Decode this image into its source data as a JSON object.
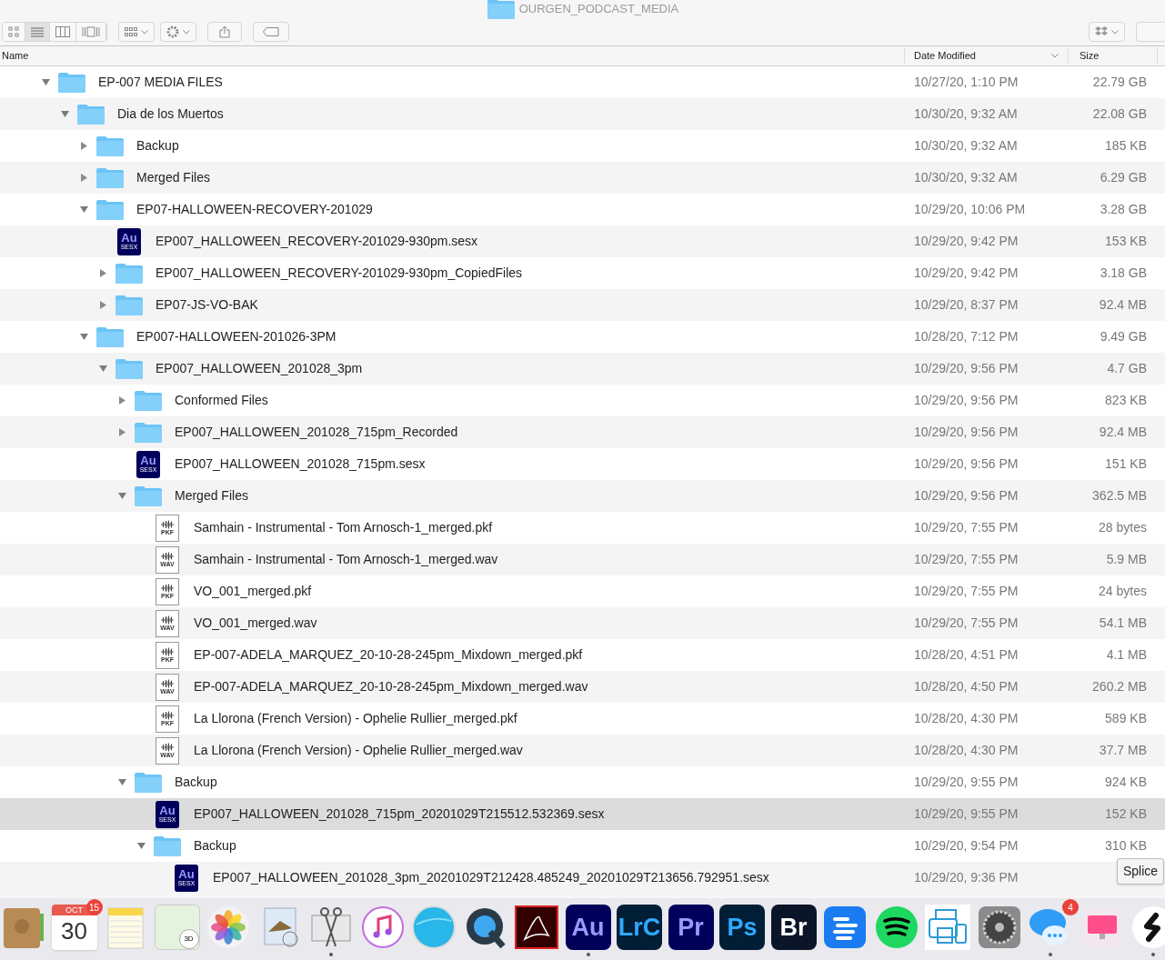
{
  "window": {
    "title": "OURGEN_PODCAST_MEDIA"
  },
  "toolbar": {
    "view_buttons": [
      {
        "kind": "icon",
        "selected": false
      },
      {
        "kind": "list",
        "selected": true
      },
      {
        "kind": "columns",
        "selected": false
      },
      {
        "kind": "gallery",
        "selected": false
      }
    ]
  },
  "table": {
    "columns": [
      {
        "label": "Name",
        "sorted": false
      },
      {
        "label": "Date Modified",
        "sorted": true
      },
      {
        "label": "Size",
        "sorted": false
      }
    ],
    "rows": [
      {
        "kind": "folder",
        "name": "EP-007 MEDIA FILES",
        "date": "10/27/20, 1:10 PM",
        "size": "22.79 GB",
        "expanded": true,
        "selected": false,
        "children": [
          {
            "kind": "folder",
            "name": "Dia de los Muertos",
            "date": "10/30/20, 9:32 AM",
            "size": "22.08 GB",
            "expanded": true,
            "selected": false,
            "children": [
              {
                "kind": "folder",
                "name": "Backup",
                "date": "10/30/20, 9:32 AM",
                "size": "185 KB",
                "expanded": false,
                "selected": false
              },
              {
                "kind": "folder",
                "name": "Merged Files",
                "date": "10/30/20, 9:32 AM",
                "size": "6.29 GB",
                "expanded": false,
                "selected": false
              },
              {
                "kind": "folder",
                "name": "EP07-HALLOWEEN-RECOVERY-201029",
                "date": "10/29/20, 10:06 PM",
                "size": "3.28 GB",
                "expanded": true,
                "selected": false,
                "children": [
                  {
                    "kind": "sesx",
                    "icon_text": [
                      "Au",
                      "SESX"
                    ],
                    "name": "EP007_HALLOWEEN_RECOVERY-201029-930pm.sesx",
                    "date": "10/29/20, 9:42 PM",
                    "size": "153 KB",
                    "selected": false
                  },
                  {
                    "kind": "folder",
                    "name": "EP007_HALLOWEEN_RECOVERY-201029-930pm_CopiedFiles",
                    "date": "10/29/20, 9:42 PM",
                    "size": "3.18 GB",
                    "expanded": false,
                    "selected": false
                  },
                  {
                    "kind": "folder",
                    "name": "EP07-JS-VO-BAK",
                    "date": "10/29/20, 8:37 PM",
                    "size": "92.4 MB",
                    "expanded": false,
                    "selected": false
                  }
                ]
              },
              {
                "kind": "folder",
                "name": "EP007-HALLOWEEN-201026-3PM",
                "date": "10/28/20, 7:12 PM",
                "size": "9.49 GB",
                "expanded": true,
                "selected": false,
                "children": [
                  {
                    "kind": "folder",
                    "name": "EP007_HALLOWEEN_201028_3pm",
                    "date": "10/29/20, 9:56 PM",
                    "size": "4.7 GB",
                    "expanded": true,
                    "selected": false,
                    "children": [
                      {
                        "kind": "folder",
                        "name": "Conformed Files",
                        "date": "10/29/20, 9:56 PM",
                        "size": "823 KB",
                        "expanded": false,
                        "selected": false
                      },
                      {
                        "kind": "folder",
                        "name": "EP007_HALLOWEEN_201028_715pm_Recorded",
                        "date": "10/29/20, 9:56 PM",
                        "size": "92.4 MB",
                        "expanded": false,
                        "selected": false
                      },
                      {
                        "kind": "sesx",
                        "icon_text": [
                          "Au",
                          "SESX"
                        ],
                        "name": "EP007_HALLOWEEN_201028_715pm.sesx",
                        "date": "10/29/20, 9:56 PM",
                        "size": "151 KB",
                        "selected": false
                      },
                      {
                        "kind": "folder",
                        "name": "Merged Files",
                        "date": "10/29/20, 9:56 PM",
                        "size": "362.5 MB",
                        "expanded": true,
                        "selected": false,
                        "children": [
                          {
                            "kind": "audio",
                            "icon_text": [
                              "PKF"
                            ],
                            "name": "Samhain - Instrumental - Tom Arnosch-1_merged.pkf",
                            "date": "10/29/20, 7:55 PM",
                            "size": "28 bytes",
                            "selected": false
                          },
                          {
                            "kind": "audio",
                            "icon_text": [
                              "WAV"
                            ],
                            "name": "Samhain - Instrumental - Tom Arnosch-1_merged.wav",
                            "date": "10/29/20, 7:55 PM",
                            "size": "5.9 MB",
                            "selected": false
                          },
                          {
                            "kind": "audio",
                            "icon_text": [
                              "PKF"
                            ],
                            "name": "VO_001_merged.pkf",
                            "date": "10/29/20, 7:55 PM",
                            "size": "24 bytes",
                            "selected": false
                          },
                          {
                            "kind": "audio",
                            "icon_text": [
                              "WAV"
                            ],
                            "name": "VO_001_merged.wav",
                            "date": "10/29/20, 7:55 PM",
                            "size": "54.1 MB",
                            "selected": false
                          },
                          {
                            "kind": "audio",
                            "icon_text": [
                              "PKF"
                            ],
                            "name": "EP-007-ADELA_MARQUEZ_20-10-28-245pm_Mixdown_merged.pkf",
                            "date": "10/28/20, 4:51 PM",
                            "size": "4.1 MB",
                            "selected": false
                          },
                          {
                            "kind": "audio",
                            "icon_text": [
                              "WAV"
                            ],
                            "name": "EP-007-ADELA_MARQUEZ_20-10-28-245pm_Mixdown_merged.wav",
                            "date": "10/28/20, 4:50 PM",
                            "size": "260.2 MB",
                            "selected": false
                          },
                          {
                            "kind": "audio",
                            "icon_text": [
                              "PKF"
                            ],
                            "name": "La Llorona (French Version) - Ophelie Rullier_merged.pkf",
                            "date": "10/28/20, 4:30 PM",
                            "size": "589 KB",
                            "selected": false
                          },
                          {
                            "kind": "audio",
                            "icon_text": [
                              "WAV"
                            ],
                            "name": "La Llorona (French Version) - Ophelie Rullier_merged.wav",
                            "date": "10/28/20, 4:30 PM",
                            "size": "37.7 MB",
                            "selected": false
                          }
                        ]
                      },
                      {
                        "kind": "folder",
                        "name": "Backup",
                        "date": "10/29/20, 9:55 PM",
                        "size": "924 KB",
                        "expanded": true,
                        "selected": false,
                        "children": [
                          {
                            "kind": "sesx",
                            "icon_text": [
                              "Au",
                              "SESX"
                            ],
                            "name": "EP007_HALLOWEEN_201028_715pm_20201029T215512.532369.sesx",
                            "date": "10/29/20, 9:55 PM",
                            "size": "152 KB",
                            "selected": true
                          },
                          {
                            "kind": "folder",
                            "name": "Backup",
                            "date": "10/29/20, 9:54 PM",
                            "size": "310 KB",
                            "expanded": true,
                            "selected": false,
                            "children": [
                              {
                                "kind": "sesx",
                                "icon_text": [
                                  "Au",
                                  "SESX"
                                ],
                                "name": "EP007_HALLOWEEN_201028_3pm_20201029T212428.485249_20201029T213656.792951.sesx",
                                "date": "10/29/20, 9:36 PM",
                                "selected": false
                              }
                            ]
                          }
                        ]
                      }
                    ]
                  }
                ]
              }
            ]
          }
        ]
      }
    ]
  },
  "tooltip": {
    "text": "Splice"
  },
  "dock": [
    {
      "kind": "contacts",
      "running": false
    },
    {
      "kind": "calendar",
      "month": "OCT",
      "day": "30",
      "badge": "15",
      "running": false
    },
    {
      "kind": "notes",
      "running": false
    },
    {
      "kind": "maps",
      "label": "3D",
      "running": false
    },
    {
      "kind": "photos",
      "running": false
    },
    {
      "kind": "mail",
      "running": false
    },
    {
      "kind": "scissors",
      "running": true
    },
    {
      "kind": "music",
      "running": false
    },
    {
      "kind": "globe",
      "running": false
    },
    {
      "kind": "quicktime",
      "running": false
    },
    {
      "kind": "acrobat",
      "running": false
    },
    {
      "kind": "tile",
      "label": "Au",
      "color": "#00005b",
      "running": true
    },
    {
      "kind": "tile",
      "label": "LrC",
      "color": "#001e36",
      "running": false
    },
    {
      "kind": "tile",
      "label": "Pr",
      "color": "#00005b",
      "running": false
    },
    {
      "kind": "tile",
      "label": "Ps",
      "color": "#001e36",
      "running": false
    },
    {
      "kind": "tile",
      "label": "Br",
      "color": "#0a1529",
      "running": false
    },
    {
      "kind": "lines",
      "running": false
    },
    {
      "kind": "spotify",
      "running": false
    },
    {
      "kind": "printer",
      "running": false
    },
    {
      "kind": "gear",
      "running": false
    },
    {
      "kind": "messages",
      "badge": "4",
      "running": true
    },
    {
      "kind": "monitor",
      "running": false
    },
    {
      "kind": "splice",
      "running": true
    }
  ]
}
